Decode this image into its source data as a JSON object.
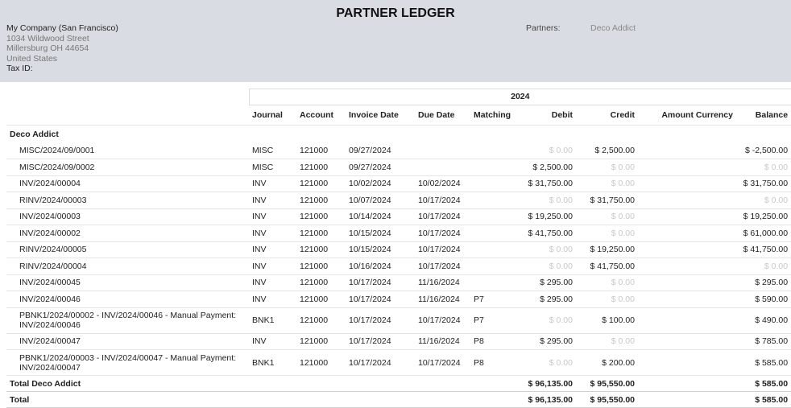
{
  "report": {
    "title": "PARTNER LEDGER",
    "company_name": "My Company (San Francisco)",
    "address_lines": [
      "1034 Wildwood Street",
      "Millersburg OH 44654",
      "United States"
    ],
    "tax_id_label": "Tax ID:",
    "partners_label": "Partners:",
    "partners_value": "Deco Addict"
  },
  "table": {
    "year": "2024",
    "columns": [
      "Journal",
      "Account",
      "Invoice Date",
      "Due Date",
      "Matching",
      "Debit",
      "Credit",
      "Amount Currency",
      "Balance"
    ],
    "partner_name": "Deco Addict",
    "rows": [
      {
        "name": "MISC/2024/09/0001",
        "journal": "MISC",
        "account": "121000",
        "invoice_date": "09/27/2024",
        "due_date": "",
        "matching": "",
        "debit": "$ 0.00",
        "credit": "$ 2,500.00",
        "amount_currency": "",
        "balance": "$ -2,500.00"
      },
      {
        "name": "MISC/2024/09/0002",
        "journal": "MISC",
        "account": "121000",
        "invoice_date": "09/27/2024",
        "due_date": "",
        "matching": "",
        "debit": "$ 2,500.00",
        "credit": "$ 0.00",
        "amount_currency": "",
        "balance": "$ 0.00"
      },
      {
        "name": "INV/2024/00004",
        "journal": "INV",
        "account": "121000",
        "invoice_date": "10/02/2024",
        "due_date": "10/02/2024",
        "matching": "",
        "debit": "$ 31,750.00",
        "credit": "$ 0.00",
        "amount_currency": "",
        "balance": "$ 31,750.00"
      },
      {
        "name": "RINV/2024/00003",
        "journal": "INV",
        "account": "121000",
        "invoice_date": "10/07/2024",
        "due_date": "10/17/2024",
        "matching": "",
        "debit": "$ 0.00",
        "credit": "$ 31,750.00",
        "amount_currency": "",
        "balance": "$ 0.00"
      },
      {
        "name": "INV/2024/00003",
        "journal": "INV",
        "account": "121000",
        "invoice_date": "10/14/2024",
        "due_date": "10/17/2024",
        "matching": "",
        "debit": "$ 19,250.00",
        "credit": "$ 0.00",
        "amount_currency": "",
        "balance": "$ 19,250.00"
      },
      {
        "name": "INV/2024/00002",
        "journal": "INV",
        "account": "121000",
        "invoice_date": "10/15/2024",
        "due_date": "10/17/2024",
        "matching": "",
        "debit": "$ 41,750.00",
        "credit": "$ 0.00",
        "amount_currency": "",
        "balance": "$ 61,000.00"
      },
      {
        "name": "RINV/2024/00005",
        "journal": "INV",
        "account": "121000",
        "invoice_date": "10/15/2024",
        "due_date": "10/17/2024",
        "matching": "",
        "debit": "$ 0.00",
        "credit": "$ 19,250.00",
        "amount_currency": "",
        "balance": "$ 41,750.00"
      },
      {
        "name": "RINV/2024/00004",
        "journal": "INV",
        "account": "121000",
        "invoice_date": "10/16/2024",
        "due_date": "10/17/2024",
        "matching": "",
        "debit": "$ 0.00",
        "credit": "$ 41,750.00",
        "amount_currency": "",
        "balance": "$ 0.00"
      },
      {
        "name": "INV/2024/00045",
        "journal": "INV",
        "account": "121000",
        "invoice_date": "10/17/2024",
        "due_date": "11/16/2024",
        "matching": "",
        "debit": "$ 295.00",
        "credit": "$ 0.00",
        "amount_currency": "",
        "balance": "$ 295.00"
      },
      {
        "name": "INV/2024/00046",
        "journal": "INV",
        "account": "121000",
        "invoice_date": "10/17/2024",
        "due_date": "11/16/2024",
        "matching": "P7",
        "debit": "$ 295.00",
        "credit": "$ 0.00",
        "amount_currency": "",
        "balance": "$ 590.00"
      },
      {
        "name": "PBNK1/2024/00002 - INV/2024/00046 - Manual Payment: INV/2024/00046",
        "journal": "BNK1",
        "account": "121000",
        "invoice_date": "10/17/2024",
        "due_date": "10/17/2024",
        "matching": "P7",
        "debit": "$ 0.00",
        "credit": "$ 100.00",
        "amount_currency": "",
        "balance": "$ 490.00"
      },
      {
        "name": "INV/2024/00047",
        "journal": "INV",
        "account": "121000",
        "invoice_date": "10/17/2024",
        "due_date": "11/16/2024",
        "matching": "P8",
        "debit": "$ 295.00",
        "credit": "$ 0.00",
        "amount_currency": "",
        "balance": "$ 785.00"
      },
      {
        "name": "PBNK1/2024/00003 - INV/2024/00047 - Manual Payment: INV/2024/00047",
        "journal": "BNK1",
        "account": "121000",
        "invoice_date": "10/17/2024",
        "due_date": "10/17/2024",
        "matching": "P8",
        "debit": "$ 0.00",
        "credit": "$ 200.00",
        "amount_currency": "",
        "balance": "$ 585.00"
      }
    ],
    "partner_total": {
      "label": "Total Deco Addict",
      "debit": "$ 96,135.00",
      "credit": "$ 95,550.00",
      "balance": "$ 585.00"
    },
    "grand_total": {
      "label": "Total",
      "debit": "$ 96,135.00",
      "credit": "$ 95,550.00",
      "balance": "$ 585.00"
    }
  }
}
